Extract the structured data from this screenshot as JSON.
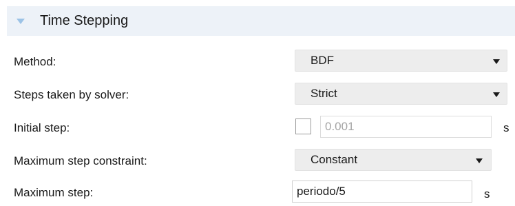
{
  "section": {
    "title": "Time Stepping"
  },
  "fields": {
    "method": {
      "label": "Method:",
      "value": "BDF"
    },
    "steps_taken": {
      "label": "Steps taken by solver:",
      "value": "Strict"
    },
    "initial_step": {
      "label": "Initial step:",
      "checked": false,
      "value": "0.001",
      "unit": "s"
    },
    "max_step_constraint": {
      "label": "Maximum step constraint:",
      "value": "Constant"
    },
    "max_step": {
      "label": "Maximum step:",
      "value": "periodo/5",
      "unit": "s"
    }
  }
}
